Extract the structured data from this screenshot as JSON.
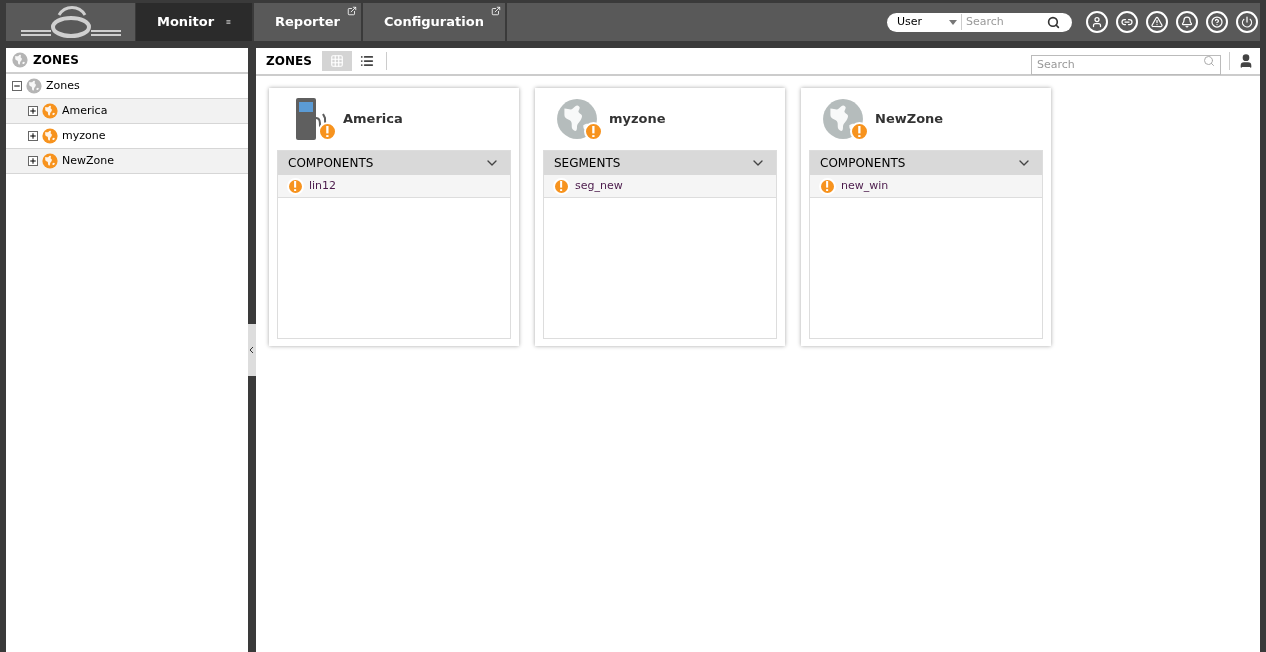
{
  "nav": {
    "tabs": [
      {
        "label": "Monitor",
        "selected": true,
        "external": false
      },
      {
        "label": "Reporter",
        "selected": false,
        "external": true
      },
      {
        "label": "Configuration",
        "selected": false,
        "external": true
      }
    ],
    "search": {
      "scope": "User",
      "placeholder": "Search"
    }
  },
  "sidebar": {
    "title": "ZONES",
    "tree": [
      {
        "label": "Zones",
        "expanded": true,
        "children": [
          {
            "label": "America",
            "expanded": false
          },
          {
            "label": "myzone",
            "expanded": false
          },
          {
            "label": "NewZone",
            "expanded": false
          }
        ]
      }
    ]
  },
  "toolbar": {
    "title": "ZONES",
    "views": [
      {
        "kind": "grid",
        "selected": true
      },
      {
        "kind": "list",
        "selected": false
      }
    ],
    "search": {
      "placeholder": "Search"
    }
  },
  "cards": [
    {
      "title": "America",
      "kind": "pump",
      "section": "COMPONENTS",
      "items": [
        "lin12"
      ]
    },
    {
      "title": "myzone",
      "kind": "globe",
      "section": "SEGMENTS",
      "items": [
        "seg_new"
      ]
    },
    {
      "title": "NewZone",
      "kind": "globe",
      "section": "COMPONENTS",
      "items": [
        "new_win"
      ]
    }
  ]
}
